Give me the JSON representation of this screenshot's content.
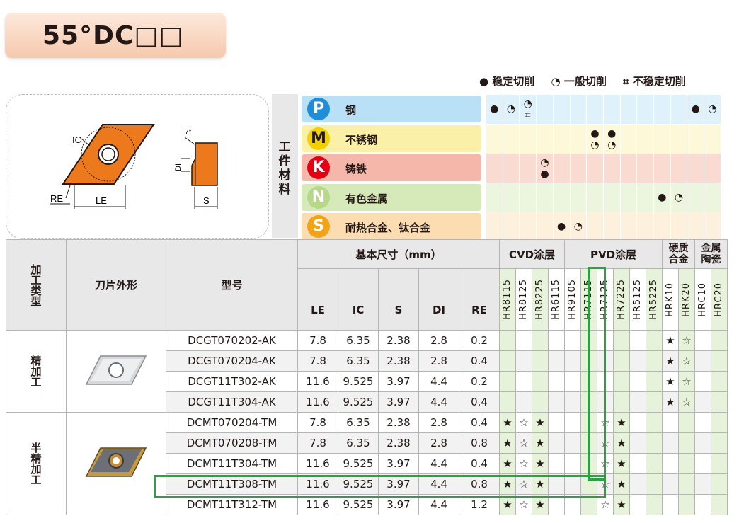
{
  "title": "55°DC□□",
  "legend": {
    "stable": "● 稳定切削",
    "general": "◔ 一般切削",
    "unstable": "⌗ 不稳定切削"
  },
  "diagram": {
    "ic_label": "IC",
    "re_label": "RE",
    "le_label": "LE",
    "di_label": "DI",
    "s_label": "S",
    "angle_label": "7°"
  },
  "material_header": "工件材料",
  "materials": [
    {
      "letter": "P",
      "name": "钢",
      "color": "#1f8ed8",
      "bg": "#b9e0f6",
      "row_bg": "#dff1fb"
    },
    {
      "letter": "M",
      "name": "不锈钢",
      "color": "#f2d100",
      "bg": "#faf0a8",
      "row_bg": "#fcf8d8",
      "dark": true
    },
    {
      "letter": "K",
      "name": "铸铁",
      "color": "#e60012",
      "bg": "#f4b7a9",
      "row_bg": "#f9dbd2"
    },
    {
      "letter": "N",
      "name": "有色金属",
      "color": "#b7d886",
      "bg": "#d6eab9",
      "row_bg": "#ecf5de"
    },
    {
      "letter": "S",
      "name": "耐热合金、钛合金",
      "color": "#f3a314",
      "bg": "#fbddb1",
      "row_bg": "#fdf0dc"
    }
  ],
  "table": {
    "col_headers": {
      "type": "加工类型",
      "shape": "刀片外形",
      "model": "型号",
      "dims": "基本尺寸（mm）",
      "cvd": "CVD涂层",
      "pvd": "PVD涂层",
      "carbide": "硬质合金",
      "cermet": "金属陶瓷"
    },
    "dim_labels": [
      "LE",
      "IC",
      "S",
      "DI",
      "RE"
    ],
    "grades": [
      "HR8115",
      "HR8125",
      "HR8225",
      "HR6115",
      "HR9105",
      "HR7115",
      "HR7125",
      "HR7225",
      "HR5125",
      "HR5225",
      "HRK10",
      "HRK20",
      "HRC10",
      "HRC20"
    ],
    "groups": [
      {
        "type": "精加工",
        "rows": [
          {
            "model": "DCGT070202-AK",
            "dims": [
              "7.8",
              "6.35",
              "2.38",
              "2.8",
              "0.2"
            ],
            "marks": [
              "",
              "",
              "",
              "",
              "",
              "",
              "",
              "",
              "",
              "",
              "★",
              "☆",
              "",
              ""
            ]
          },
          {
            "model": "DCGT070204-AK",
            "dims": [
              "7.8",
              "6.35",
              "2.38",
              "2.8",
              "0.4"
            ],
            "marks": [
              "",
              "",
              "",
              "",
              "",
              "",
              "",
              "",
              "",
              "",
              "★",
              "☆",
              "",
              ""
            ]
          },
          {
            "model": "DCGT11T302-AK",
            "dims": [
              "11.6",
              "9.525",
              "3.97",
              "4.4",
              "0.2"
            ],
            "marks": [
              "",
              "",
              "",
              "",
              "",
              "",
              "",
              "",
              "",
              "",
              "★",
              "☆",
              "",
              ""
            ]
          },
          {
            "model": "DCGT11T304-AK",
            "dims": [
              "11.6",
              "9.525",
              "3.97",
              "4.4",
              "0.4"
            ],
            "marks": [
              "",
              "",
              "",
              "",
              "",
              "",
              "",
              "",
              "",
              "",
              "★",
              "☆",
              "",
              ""
            ]
          }
        ]
      },
      {
        "type": "半精加工",
        "rows": [
          {
            "model": "DCMT070204-TM",
            "dims": [
              "7.8",
              "6.35",
              "2.38",
              "2.8",
              "0.4"
            ],
            "marks": [
              "★",
              "☆",
              "★",
              "",
              "",
              "",
              "☆",
              "★",
              "",
              "",
              "",
              "",
              "",
              ""
            ]
          },
          {
            "model": "DCMT070208-TM",
            "dims": [
              "7.8",
              "6.35",
              "2.38",
              "2.8",
              "0.8"
            ],
            "marks": [
              "★",
              "☆",
              "★",
              "",
              "",
              "",
              "☆",
              "★",
              "",
              "",
              "",
              "",
              "",
              ""
            ]
          },
          {
            "model": "DCMT11T304-TM",
            "dims": [
              "11.6",
              "9.525",
              "3.97",
              "4.4",
              "0.4"
            ],
            "marks": [
              "★",
              "☆",
              "★",
              "",
              "",
              "",
              "☆",
              "★",
              "",
              "",
              "",
              "",
              "",
              ""
            ]
          },
          {
            "model": "DCMT11T308-TM",
            "dims": [
              "11.6",
              "9.525",
              "3.97",
              "4.4",
              "0.8"
            ],
            "marks": [
              "★",
              "☆",
              "★",
              "",
              "",
              "",
              "☆",
              "★",
              "",
              "",
              "",
              "",
              "",
              ""
            ]
          },
          {
            "model": "DCMT11T312-TM",
            "dims": [
              "11.6",
              "9.525",
              "3.97",
              "4.4",
              "1.2"
            ],
            "marks": [
              "★",
              "☆",
              "★",
              "",
              "",
              "",
              "☆",
              "★",
              "",
              "",
              "",
              "",
              "",
              ""
            ]
          }
        ]
      }
    ]
  },
  "applicability": [
    [
      "●",
      "◔",
      "◔⌗",
      "",
      "",
      "",
      "",
      "",
      "",
      "",
      "",
      "",
      "●",
      "◔"
    ],
    [
      "",
      "",
      "",
      "",
      "",
      "",
      "●◔",
      "●◔",
      "",
      "",
      "",
      "",
      "",
      ""
    ],
    [
      "",
      "",
      "",
      "◔●",
      "",
      "",
      "",
      "",
      "",
      "",
      "",
      "",
      "",
      ""
    ],
    [
      "",
      "",
      "",
      "",
      "",
      "",
      "",
      "",
      "",
      "",
      "●",
      "◔",
      "",
      ""
    ],
    [
      "",
      "",
      "",
      "",
      "●",
      "◔",
      "",
      "",
      "",
      "",
      "",
      "",
      "",
      ""
    ]
  ]
}
